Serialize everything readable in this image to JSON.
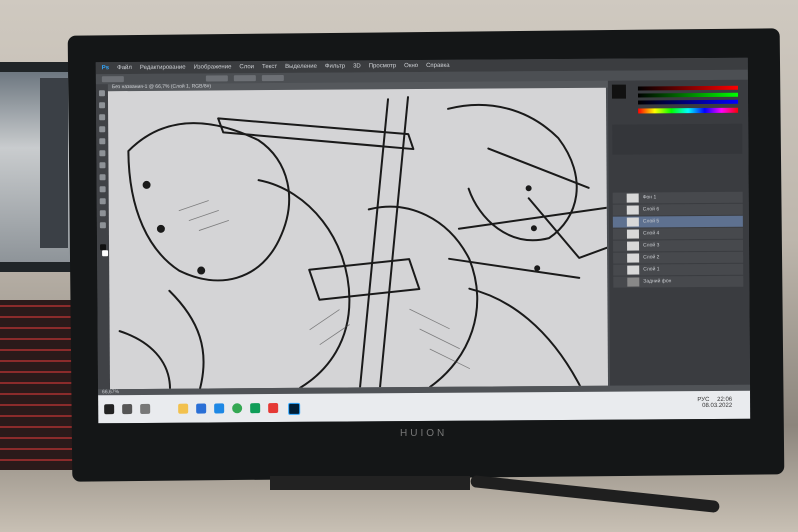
{
  "scene": {
    "monitor_brand": "HUION"
  },
  "app": {
    "menu_items": [
      "Ps",
      "Файл",
      "Редактирование",
      "Изображение",
      "Слои",
      "Текст",
      "Выделение",
      "Фильтр",
      "3D",
      "Просмотр",
      "Окно",
      "Справка"
    ],
    "document_tab": "Без названия-1 @ 66,7% (Слой 1, RGB/8#)",
    "status_text": "66,67%",
    "layers": [
      {
        "name": "Фон 1",
        "selected": false
      },
      {
        "name": "Слой 6",
        "selected": false
      },
      {
        "name": "Слой 5",
        "selected": true
      },
      {
        "name": "Слой 4",
        "selected": false
      },
      {
        "name": "Слой 3",
        "selected": false
      },
      {
        "name": "Слой 2",
        "selected": false
      },
      {
        "name": "Слой 1",
        "selected": false
      },
      {
        "name": "Задний фон",
        "selected": false
      }
    ]
  },
  "taskbar": {
    "time": "22:06",
    "date": "08.03.2022",
    "lang": "РУС"
  }
}
